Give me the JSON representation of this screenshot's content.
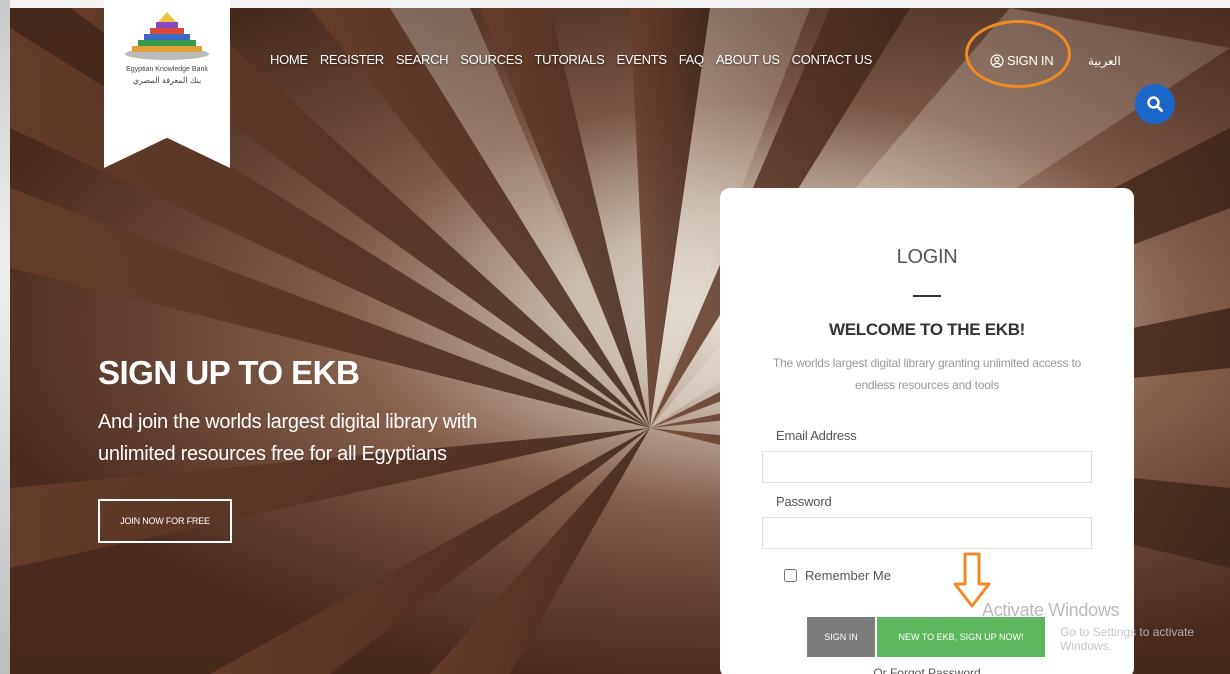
{
  "logo": {
    "text_en": "Egyptian Knowledge Bank",
    "text_ar": "بنك المعرفة المصري"
  },
  "nav": {
    "items": [
      "HOME",
      "REGISTER",
      "SEARCH",
      "SOURCES",
      "TUTORIALS",
      "EVENTS",
      "FAQ",
      "ABOUT US",
      "CONTACT US"
    ],
    "sign_in": "SIGN IN",
    "arabic": "العربية"
  },
  "hero": {
    "title": "SIGN UP TO EKB",
    "subtitle": "And join the worlds largest digital library with unlimited resources free for all Egyptians",
    "cta": "JOIN NOW FOR FREE"
  },
  "login": {
    "title": "LOGIN",
    "welcome": "WELCOME TO THE EKB!",
    "description": "The worlds largest digital library granting unlimited access to endless resources and tools",
    "email_label": "Email Address",
    "email_value": "",
    "password_label": "Password",
    "password_value": "",
    "remember_label": "Remember Me",
    "sign_in_button": "SIGN IN",
    "sign_up_button": "NEW TO EKB, SIGN UP NOW!",
    "forgot_link": "Or Forgot Password"
  },
  "watermark": {
    "title": "Activate Windows",
    "subtitle": "Go to Settings to activate Windows."
  },
  "colors": {
    "accent_orange": "#f08a24",
    "search_blue": "#1a66c9",
    "signup_green": "#5cb85c",
    "signin_gray": "#7c7c7c"
  }
}
